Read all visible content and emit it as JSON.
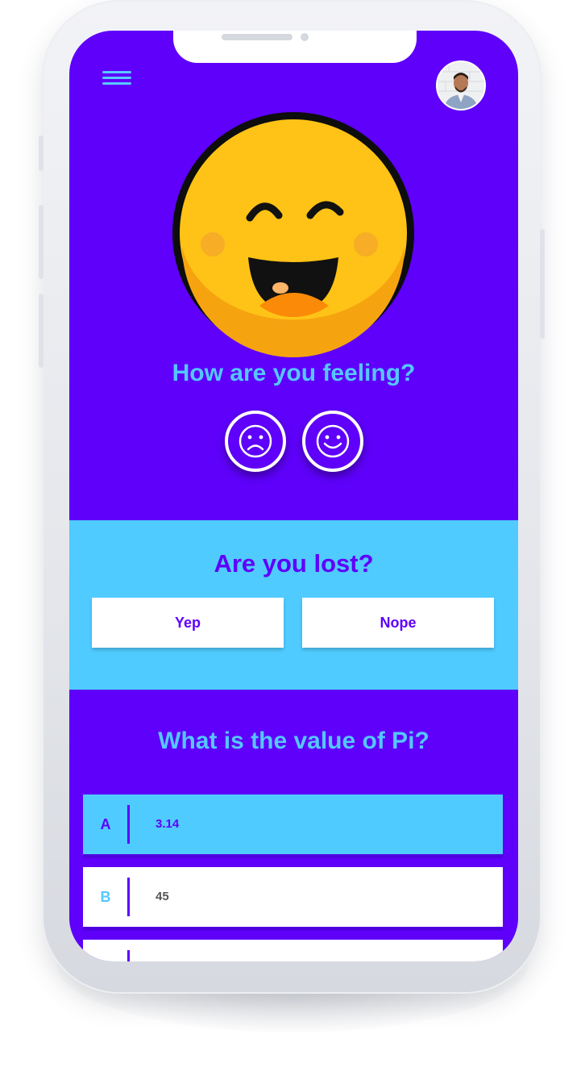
{
  "feeling": {
    "question": "How are you feeling?",
    "sad_icon": "sad-face-icon",
    "happy_icon": "happy-face-icon"
  },
  "lost": {
    "question": "Are you lost?",
    "yes_label": "Yep",
    "no_label": "Nope"
  },
  "quiz": {
    "question": "What is the value of Pi?",
    "options": [
      {
        "letter": "A",
        "value": "3.14",
        "selected": true
      },
      {
        "letter": "B",
        "value": "45",
        "selected": false
      },
      {
        "letter": "",
        "value": "",
        "selected": false
      }
    ]
  },
  "colors": {
    "primary": "#5e00fa",
    "accent": "#55c7ff",
    "light_blue": "#50cbff",
    "emoji_yellow": "#fec316"
  }
}
